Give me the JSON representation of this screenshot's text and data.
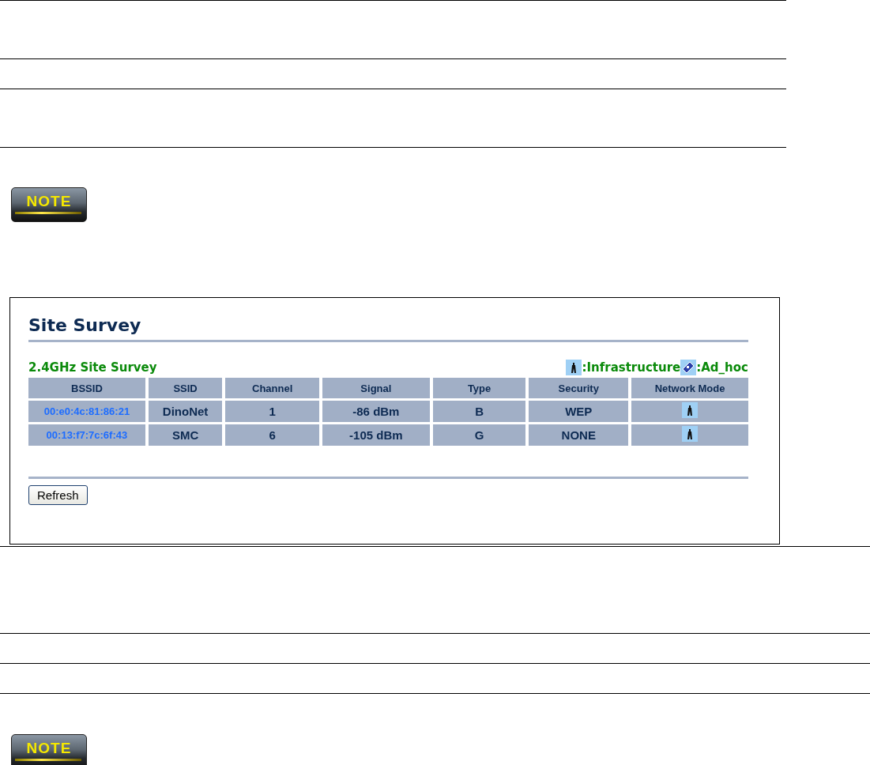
{
  "notes": [
    {
      "label": "NOTE"
    },
    {
      "label": "NOTE"
    }
  ],
  "site_survey": {
    "title": "Site Survey",
    "section_title": "2.4GHz Site Survey",
    "legend": [
      {
        "kind": "infrastructure",
        "label": ":Infrastructure"
      },
      {
        "kind": "ad_hoc",
        "label": ":Ad_hoc"
      }
    ],
    "columns": [
      "BSSID",
      "SSID",
      "Channel",
      "Signal",
      "Type",
      "Security",
      "Network Mode"
    ],
    "rows": [
      {
        "bssid": "00:e0:4c:81:86:21",
        "ssid": "DinoNet",
        "channel": "1",
        "signal": "-86 dBm",
        "type": "B",
        "security": "WEP",
        "kind": "infrastructure"
      },
      {
        "bssid": "00:13:f7:7c:6f:43",
        "ssid": "SMC",
        "channel": "6",
        "signal": "-105 dBm",
        "type": "G",
        "security": "NONE",
        "kind": "infrastructure"
      }
    ],
    "buttons": [
      "Refresh"
    ]
  }
}
